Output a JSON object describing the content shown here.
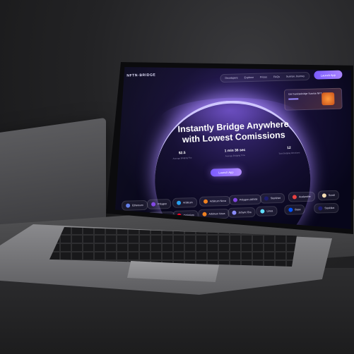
{
  "site": {
    "logo": "NFTN◦BRIDGE",
    "nav_items": [
      "Developers",
      "Explorer",
      "Prices",
      "FAQs",
      "Sunrise Journey"
    ],
    "launch_app_top": "Launch App",
    "nft_card_text": "Get Sunrisebridge Sunrise NFT",
    "headline_line1": "Instantly Bridge Anywhere",
    "headline_line2": "with Lowest Comissions",
    "stats": [
      {
        "value": "$2.5",
        "label": "Average Bridging Fee"
      },
      {
        "value": "1 min 36 sec",
        "label": "Average Bridging Time"
      },
      {
        "value": "12",
        "label": "Total Bridging Directions"
      }
    ],
    "launch_app_main": "Launch App"
  },
  "chains": [
    {
      "name": "Ethereum",
      "color": "#627eea"
    },
    {
      "name": "Polygon",
      "color": "#8247e5"
    },
    {
      "name": "Arbitrum",
      "color": "#28a0f0"
    },
    {
      "name": "Arbitrum Nova",
      "color": "#ef8220"
    },
    {
      "name": "Polygon zkEVM",
      "color": "#8247e5"
    },
    {
      "name": "StarkNet",
      "color": "#1c1c6f"
    },
    {
      "name": "Avalanche",
      "color": "#e84142"
    },
    {
      "name": "Scroll",
      "color": "#f5deb3"
    },
    {
      "name": "Polygon",
      "color": "#8247e5"
    },
    {
      "name": "BNB Chain",
      "color": "#f3ba2f"
    },
    {
      "name": "Optimism",
      "color": "#ff0420"
    },
    {
      "name": "Arbitrum Nova",
      "color": "#ef8220"
    },
    {
      "name": "zkSync Era",
      "color": "#8c8dfc"
    },
    {
      "name": "Linea",
      "color": "#61dfff"
    },
    {
      "name": "Base",
      "color": "#0052ff"
    },
    {
      "name": "StarkNet",
      "color": "#1c1c6f"
    }
  ]
}
